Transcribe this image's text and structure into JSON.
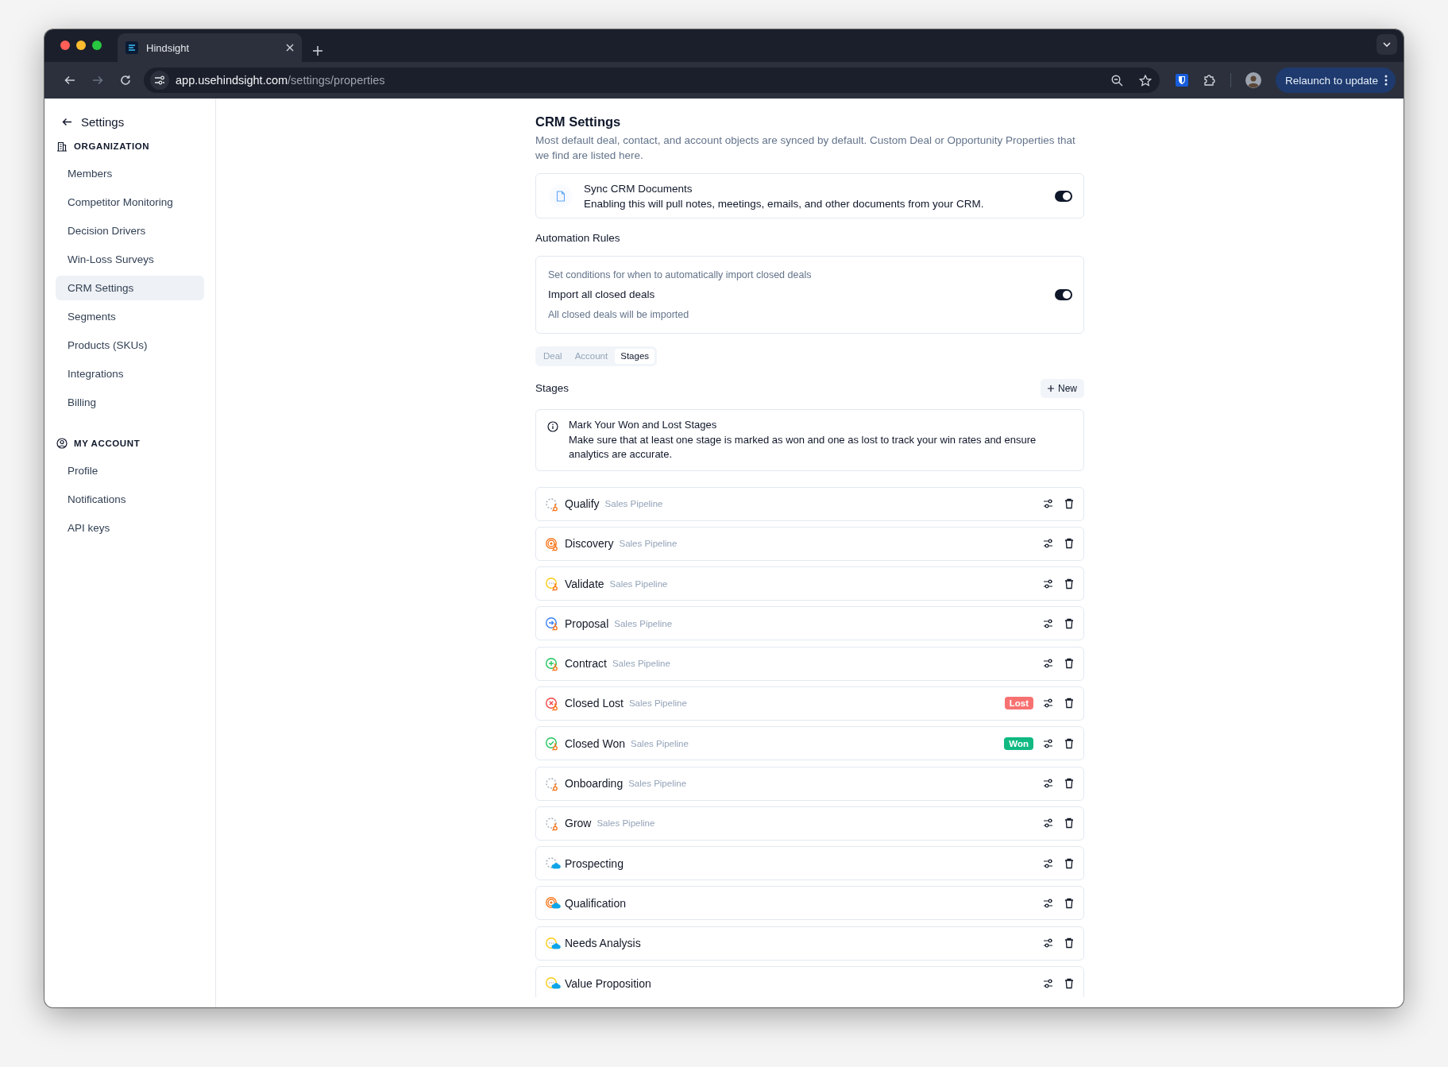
{
  "browser": {
    "tab_title": "Hindsight",
    "url_host": "app.usehindsight.com",
    "url_path": "/settings/properties",
    "relaunch_button": "Relaunch to update"
  },
  "sidebar": {
    "back_label": "Settings",
    "sections": [
      {
        "kind": "organization",
        "heading": "ORGANIZATION",
        "items": [
          {
            "label": "Members",
            "selected": false
          },
          {
            "label": "Competitor Monitoring",
            "selected": false
          },
          {
            "label": "Decision Drivers",
            "selected": false
          },
          {
            "label": "Win-Loss Surveys",
            "selected": false
          },
          {
            "label": "CRM Settings",
            "selected": true
          },
          {
            "label": "Segments",
            "selected": false
          },
          {
            "label": "Products (SKUs)",
            "selected": false
          },
          {
            "label": "Integrations",
            "selected": false
          },
          {
            "label": "Billing",
            "selected": false
          }
        ]
      },
      {
        "kind": "account",
        "heading": "MY ACCOUNT",
        "items": [
          {
            "label": "Profile",
            "selected": false
          },
          {
            "label": "Notifications",
            "selected": false
          },
          {
            "label": "API keys",
            "selected": false
          }
        ]
      }
    ]
  },
  "main": {
    "title": "CRM Settings",
    "description": "Most default deal, contact, and account objects are synced by default. Custom Deal or Opportunity Properties that we find are listed here.",
    "sync_card": {
      "title": "Sync CRM Documents",
      "description": "Enabling this will pull notes, meetings, emails, and other documents from your CRM.",
      "on": true
    },
    "automation": {
      "heading": "Automation Rules",
      "hint": "Set conditions for when to automatically import closed deals",
      "rule": "Import all closed deals",
      "rule_note": "All closed deals will be imported",
      "on": true
    },
    "tabs": [
      {
        "label": "Deal",
        "selected": false
      },
      {
        "label": "Account",
        "selected": false
      },
      {
        "label": "Stages",
        "selected": true
      }
    ],
    "stages": {
      "heading": "Stages",
      "new_button": "New",
      "notice": {
        "title": "Mark Your Won and Lost Stages",
        "text": "Make sure that at least one stage is marked as won and one as lost to track your win rates and ensure analytics are accurate."
      },
      "rows": [
        {
          "name": "Qualify",
          "pipeline": "Sales Pipeline",
          "status": {
            "kind": "empty"
          },
          "source": {
            "kind": "hubspot"
          }
        },
        {
          "name": "Discovery",
          "pipeline": "Sales Pipeline",
          "status": {
            "kind": "target"
          },
          "source": {
            "kind": "hubspot"
          }
        },
        {
          "name": "Validate",
          "pipeline": "Sales Pipeline",
          "status": {
            "kind": "pending"
          },
          "source": {
            "kind": "hubspot"
          }
        },
        {
          "name": "Proposal",
          "pipeline": "Sales Pipeline",
          "status": {
            "kind": "proposal"
          },
          "source": {
            "kind": "hubspot"
          }
        },
        {
          "name": "Contract",
          "pipeline": "Sales Pipeline",
          "status": {
            "kind": "contract"
          },
          "source": {
            "kind": "hubspot"
          }
        },
        {
          "name": "Closed Lost",
          "pipeline": "Sales Pipeline",
          "status": {
            "kind": "lost"
          },
          "source": {
            "kind": "hubspot"
          },
          "badge": {
            "label": "Lost",
            "kind": "lost"
          }
        },
        {
          "name": "Closed Won",
          "pipeline": "Sales Pipeline",
          "status": {
            "kind": "won"
          },
          "source": {
            "kind": "hubspot"
          },
          "badge": {
            "label": "Won",
            "kind": "won"
          }
        },
        {
          "name": "Onboarding",
          "pipeline": "Sales Pipeline",
          "status": {
            "kind": "empty"
          },
          "source": {
            "kind": "hubspot"
          }
        },
        {
          "name": "Grow",
          "pipeline": "Sales Pipeline",
          "status": {
            "kind": "empty"
          },
          "source": {
            "kind": "hubspot"
          }
        },
        {
          "name": "Prospecting",
          "status": {
            "kind": "empty"
          },
          "source": {
            "kind": "salesforce"
          }
        },
        {
          "name": "Qualification",
          "status": {
            "kind": "target"
          },
          "source": {
            "kind": "salesforce"
          }
        },
        {
          "name": "Needs Analysis",
          "status": {
            "kind": "pending"
          },
          "source": {
            "kind": "salesforce"
          }
        },
        {
          "name": "Value Proposition",
          "status": {
            "kind": "pending"
          },
          "source": {
            "kind": "salesforce"
          }
        }
      ]
    }
  }
}
